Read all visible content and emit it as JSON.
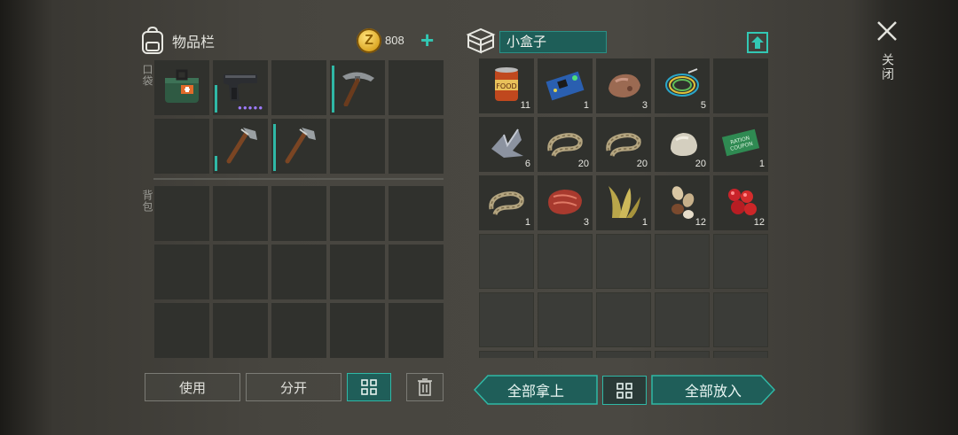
{
  "inventory": {
    "title": "物品栏",
    "coins": "808",
    "pocket_label": "口袋",
    "backpack_label": "背包"
  },
  "pocket_slots": [
    {
      "icon": "first-aid-kit-icon",
      "count": "",
      "durability": 0,
      "dots": ""
    },
    {
      "icon": "pistol-icon",
      "count": "",
      "durability": 0.55,
      "dots": "●●●●●"
    },
    {
      "icon": "",
      "count": "",
      "durability": 0,
      "dots": ""
    },
    {
      "icon": "pickaxe-icon",
      "count": "",
      "durability": 0.95,
      "dots": ""
    },
    {
      "icon": "",
      "count": "",
      "durability": 0,
      "dots": ""
    },
    {
      "icon": "",
      "count": "",
      "durability": 0,
      "dots": ""
    },
    {
      "icon": "stone-axe-icon",
      "count": "",
      "durability": 0.3,
      "dots": ""
    },
    {
      "icon": "stone-axe-icon",
      "count": "",
      "durability": 0.95,
      "dots": ""
    },
    {
      "icon": "",
      "count": "",
      "durability": 0,
      "dots": ""
    },
    {
      "icon": "",
      "count": "",
      "durability": 0,
      "dots": ""
    }
  ],
  "container": {
    "title": "小盒子",
    "items": [
      {
        "icon": "canned-food-icon",
        "count": "11"
      },
      {
        "icon": "circuit-board-icon",
        "count": "1"
      },
      {
        "icon": "ore-icon",
        "count": "3"
      },
      {
        "icon": "wires-icon",
        "count": "5"
      },
      {
        "icon": "",
        "count": ""
      },
      {
        "icon": "metal-scrap-icon",
        "count": "6"
      },
      {
        "icon": "rope-icon",
        "count": "20"
      },
      {
        "icon": "rope-icon",
        "count": "20"
      },
      {
        "icon": "stone-icon",
        "count": "20"
      },
      {
        "icon": "ration-coupon-icon",
        "count": "1"
      },
      {
        "icon": "rope-icon",
        "count": "1"
      },
      {
        "icon": "raw-meat-icon",
        "count": "3"
      },
      {
        "icon": "plant-fiber-icon",
        "count": "1"
      },
      {
        "icon": "seeds-icon",
        "count": "12"
      },
      {
        "icon": "berries-icon",
        "count": "12"
      }
    ],
    "coupon_text": "RATION COUPON"
  },
  "buttons": {
    "use": "使用",
    "split": "分开",
    "take_all": "全部拿上",
    "put_all": "全部放入",
    "close": "关闭"
  }
}
